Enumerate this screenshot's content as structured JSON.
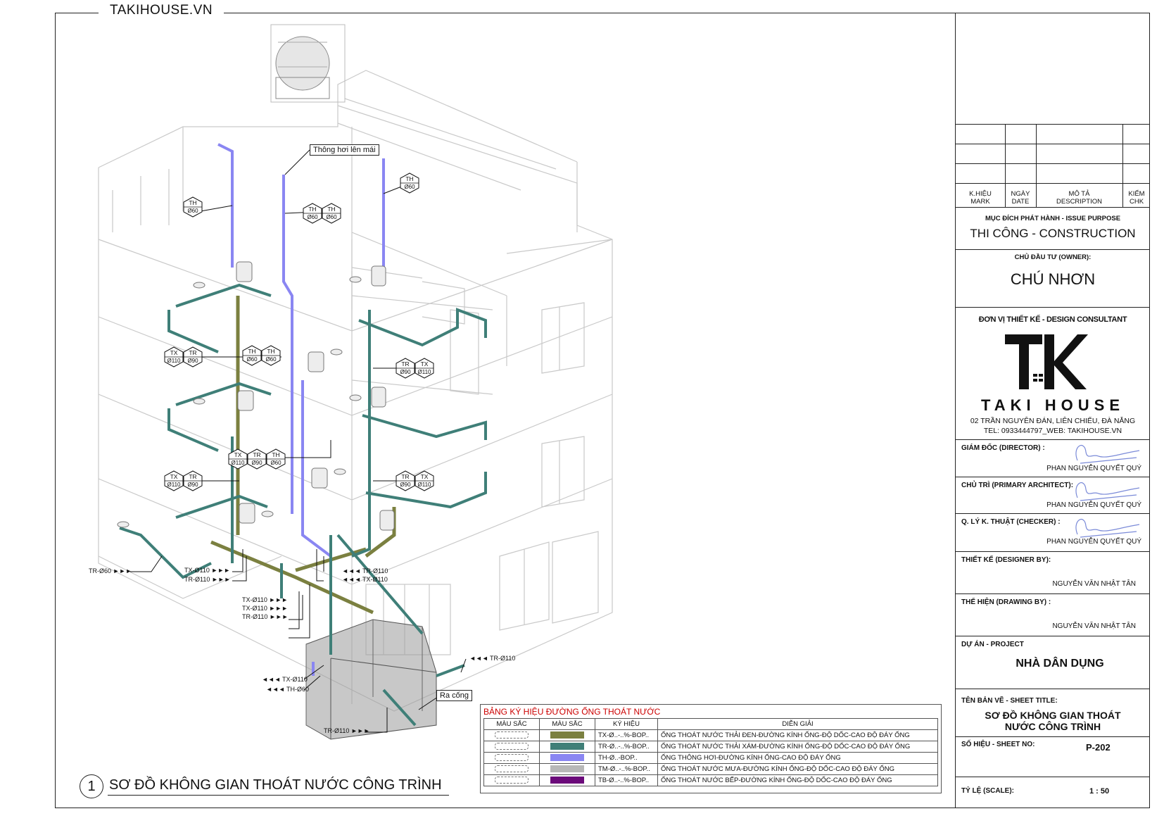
{
  "brand_top": "TAKIHOUSE.VN",
  "drawing": {
    "number": "1",
    "title": "SƠ ĐỒ KHÔNG GIAN THOÁT NƯỚC CÔNG TRÌNH",
    "callouts": {
      "vent_to_roof": "Thông hơi lên mái",
      "sewer_out": "Ra cống"
    },
    "hex_tags": [
      {
        "code": "TH",
        "dia": "Ø60"
      },
      {
        "code": "TH",
        "dia": "Ø60"
      },
      {
        "code": "TH",
        "dia": "Ø60"
      },
      {
        "code": "TH",
        "dia": "Ø60"
      },
      {
        "code": "TX",
        "dia": "Ø110"
      },
      {
        "code": "TR",
        "dia": "Ø90"
      },
      {
        "code": "TH",
        "dia": "Ø60"
      },
      {
        "code": "TH",
        "dia": "Ø60"
      },
      {
        "code": "TR",
        "dia": "Ø90"
      },
      {
        "code": "TX",
        "dia": "Ø110"
      },
      {
        "code": "TX",
        "dia": "Ø110"
      },
      {
        "code": "TR",
        "dia": "Ø90"
      },
      {
        "code": "TH",
        "dia": "Ø60"
      },
      {
        "code": "TX",
        "dia": "Ø110"
      },
      {
        "code": "TR",
        "dia": "Ø90"
      },
      {
        "code": "TR",
        "dia": "Ø90"
      },
      {
        "code": "TX",
        "dia": "Ø110"
      }
    ],
    "pipe_labels": [
      "TR-Ø60 ►►►",
      "TX-Ø110 ►►►",
      "TR-Ø110 ►►►",
      "◄◄◄ TR-Ø110",
      "◄◄◄ TX-Ø110",
      "TX-Ø110 ►►►",
      "TX-Ø110 ►►►",
      "TR-Ø110 ►►►",
      "◄◄◄ TR-Ø110",
      "◄◄◄ TX-Ø110",
      "◄◄◄ TH-Ø60",
      "TR-Ø110 ►►►"
    ]
  },
  "legend": {
    "title": "BẢNG KÝ HIỆU ĐƯỜNG ỐNG THOÁT NƯỚC",
    "headers": [
      "MÀU SẮC",
      "MÀU SẮC",
      "KÝ HIỆU",
      "DIỄN GIẢI"
    ],
    "rows": [
      {
        "color": "#7b8040",
        "code": "TX-Ø..-..%-BOP..",
        "desc": "ỐNG THOÁT NƯỚC THẢI ĐEN-ĐƯỜNG KÍNH ỐNG-ĐỘ DỐC-CAO ĐỘ ĐÁY ỐNG"
      },
      {
        "color": "#3f7f78",
        "code": "TR-Ø..-..%-BOP..",
        "desc": "ỐNG THOÁT NƯỚC THẢI XÁM-ĐƯỜNG KÍNH ỐNG-ĐỘ DỐC-CAO ĐỘ ĐÁY ỐNG"
      },
      {
        "color": "#8a86f2",
        "code": "TH-Ø..-BOP..",
        "desc": "ỐNG THÔNG HƠI-ĐƯỜNG KÍNH ỐNG-CAO ĐỘ ĐÁY ỐNG"
      },
      {
        "color": "#b8b8b8",
        "code": "TM-Ø..-..%-BOP..",
        "desc": "ỐNG THOÁT NƯỚC MƯA-ĐƯỜNG KÍNH ỐNG-ĐỘ DỐC-CAO ĐỘ ĐÁY ỐNG"
      },
      {
        "color": "#6b0a7a",
        "code": "TB-Ø..-..%-BOP..",
        "desc": "ỐNG THOÁT NƯỚC BẾP-ĐƯỜNG KÍNH ỐNG-ĐỘ DỐC-CAO ĐỘ ĐÁY ỐNG"
      }
    ]
  },
  "title_block": {
    "revision_headers": [
      {
        "vi": "K.HIỆU",
        "en": "MARK"
      },
      {
        "vi": "NGÀY",
        "en": "DATE"
      },
      {
        "vi": "MÔ TẢ",
        "en": "DESCRIPTION"
      },
      {
        "vi": "KIỂM",
        "en": "CHK"
      }
    ],
    "issue_purpose_label": "MỤC ĐÍCH PHÁT HÀNH - ISSUE PURPOSE",
    "issue_purpose": "THI CÔNG - CONSTRUCTION",
    "owner_label": "CHỦ ĐẦU TƯ (OWNER):",
    "owner": "CHÚ NHƠN",
    "consultant_label": "ĐƠN VỊ THIẾT KẾ - DESIGN CONSULTANT",
    "company_name": "TAKI HOUSE",
    "address": "02 TRẦN NGUYÊN ĐÁN, LIÊN CHIỂU, ĐÀ NẴNG",
    "contact": "TEL: 0933444797_WEB: TAKIHOUSE.VN",
    "director_label": "GIÁM ĐỐC (DIRECTOR) :",
    "director": "PHAN NGUYỄN QUYẾT QUÝ",
    "architect_label": "CHỦ TRÌ (PRIMARY ARCHITECT):",
    "architect": "PHAN NGUYỄN QUYẾT QUÝ",
    "checker_label": "Q. LÝ K. THUẬT (CHECKER) :",
    "checker": "PHAN NGUYỄN QUYẾT QUÝ",
    "designer_label": "THIẾT KẾ (DESIGNER BY):",
    "designer": "NGUYỄN VĂN NHẬT TÂN",
    "drawn_label": "THỂ HIỆN (DRAWING BY) :",
    "drawn": "NGUYỄN VĂN NHẬT TÂN",
    "project_label": "DỰ ÁN -  PROJECT",
    "project": "NHÀ DÂN DỤNG",
    "sheet_title_label": "TÊN BẢN VẼ - SHEET TITLE:",
    "sheet_title": "SƠ ĐỒ KHÔNG GIAN THOÁT NƯỚC CÔNG TRÌNH",
    "sheet_no_label": "SỐ HIỆU - SHEET NO:",
    "sheet_no": "P-202",
    "scale_label": "TỶ LỆ (SCALE):",
    "scale": "1 : 50"
  },
  "colors": {
    "black_water": "#7b8040",
    "grey_water": "#3f7f78",
    "vent": "#8a86f2",
    "building_lines": "#c9c9c9"
  }
}
